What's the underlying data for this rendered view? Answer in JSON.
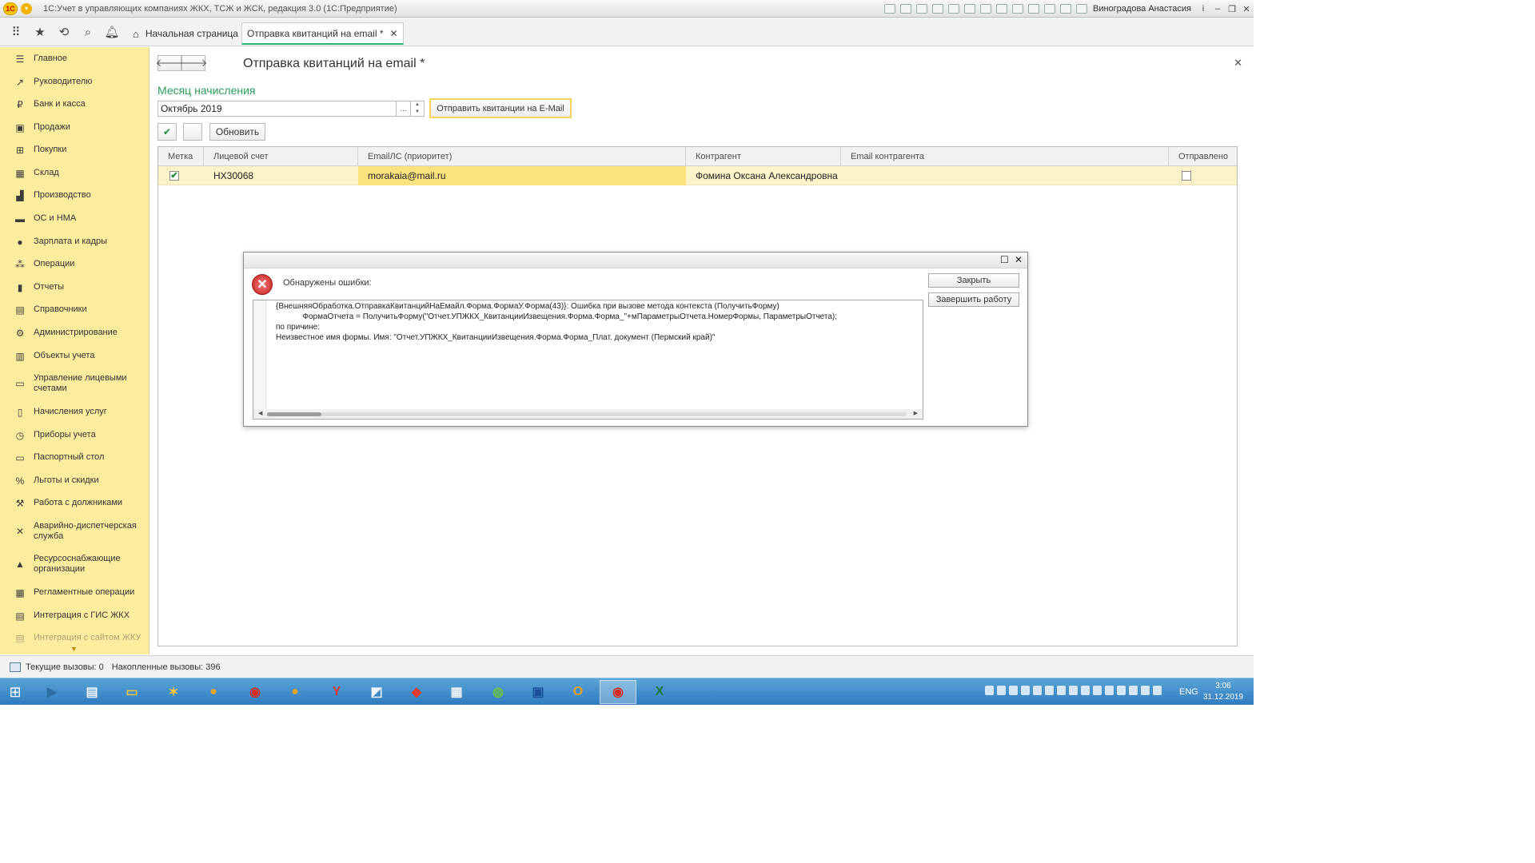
{
  "window": {
    "app_title": "1С:Учет в управляющих компаниях ЖКХ, ТСЖ и ЖСК, редакция 3.0  (1С:Предприятие)",
    "logo_text": "1С",
    "user_name": "Виноградова Анастасия",
    "controls": {
      "info": "i",
      "minimize": "–",
      "restore": "❐",
      "close": "✕"
    }
  },
  "tabs": [
    {
      "label": "Начальная страница",
      "icon": "home-icon"
    },
    {
      "label": "Отправка квитанций на email *",
      "active": true,
      "close": "✕"
    }
  ],
  "toolbar_icons": [
    "apps-grid-icon",
    "star-icon",
    "history-icon",
    "search-icon",
    "bell-icon"
  ],
  "sidebar": {
    "items": [
      {
        "label": "Главное",
        "icon": "menu-icon"
      },
      {
        "label": "Руководителю",
        "icon": "trend-icon"
      },
      {
        "label": "Банк и касса",
        "icon": "ruble-icon"
      },
      {
        "label": "Продажи",
        "icon": "bag-icon"
      },
      {
        "label": "Покупки",
        "icon": "cart-icon"
      },
      {
        "label": "Склад",
        "icon": "warehouse-icon"
      },
      {
        "label": "Производство",
        "icon": "factory-icon"
      },
      {
        "label": "ОС и НМА",
        "icon": "truck-icon"
      },
      {
        "label": "Зарплата и кадры",
        "icon": "person-icon"
      },
      {
        "label": "Операции",
        "icon": "operations-icon"
      },
      {
        "label": "Отчеты",
        "icon": "bar-chart-icon"
      },
      {
        "label": "Справочники",
        "icon": "book-icon"
      },
      {
        "label": "Администрирование",
        "icon": "gear-icon"
      },
      {
        "label": "Объекты учета",
        "icon": "buildings-icon"
      },
      {
        "label": "Управление лицевыми счетами",
        "icon": "card-icon"
      },
      {
        "label": "Начисления услуг",
        "icon": "document-icon"
      },
      {
        "label": "Приборы учета",
        "icon": "meter-icon"
      },
      {
        "label": "Паспортный стол",
        "icon": "passport-icon"
      },
      {
        "label": "Льготы и скидки",
        "icon": "percent-icon"
      },
      {
        "label": "Работа с должниками",
        "icon": "gavel-icon"
      },
      {
        "label": "Аварийно-диспетчерская служба",
        "icon": "tools-icon"
      },
      {
        "label": "Ресурсоснабжающие организации",
        "icon": "resource-icon"
      },
      {
        "label": "Регламентные операции",
        "icon": "regulation-icon"
      },
      {
        "label": "Интеграция с ГИС ЖКХ",
        "icon": "integration-icon"
      },
      {
        "label": "Интеграция с сайтом ЖКУ",
        "icon": "site-icon"
      }
    ]
  },
  "form": {
    "title": "Отправка квитанций на email *",
    "back": "🡐",
    "forward": "🡒",
    "close": "✕",
    "month_label": "Месяц начисления",
    "month_value": "Октябрь 2019",
    "select_button": "...",
    "send_button": "Отправить квитанции на E-Mail",
    "check_all": "✔",
    "refresh_button": "Обновить"
  },
  "table": {
    "columns": [
      "Метка",
      "Лицевой счет",
      "EmailЛС (приоритет)",
      "Контрагент",
      "Email контрагента",
      "Отправлено"
    ],
    "rows": [
      {
        "mark": "✔",
        "account": "НХ30068",
        "email": "morakaia@mail.ru",
        "counterparty": "Фомина Оксана Александровна",
        "counterparty_email": "",
        "sent": ""
      }
    ]
  },
  "error_dialog": {
    "maximize": "☐",
    "close": "✕",
    "icon": "✕",
    "title": "Обнаружены ошибки:",
    "lines": [
      "{ВнешняяОбработка.ОтправкаКвитанцийНаЕмайл.Форма.ФормаУ.Форма(43)}: Ошибка при вызове метода контекста (ПолучитьФорму)",
      "            ФормаОтчета = ПолучитьФорму(\"Отчет.УПЖКХ_КвитанцииИзвещения.Форма.Форма_\"+мПараметрыОтчета.НомерФормы, ПараметрыОтчета);",
      "по причине:",
      "Неизвестное имя формы. Имя: \"Отчет.УПЖКХ_КвитанцииИзвещения.Форма.Форма_Плат. документ (Пермский край)\""
    ],
    "close_button": "Закрыть",
    "exit_button": "Завершить работу"
  },
  "status_bar": {
    "current_calls": "Текущие вызовы: 0",
    "accumulated_calls": "Накопленные вызовы: 396"
  },
  "taskbar": {
    "language": "ENG",
    "time": "3:06",
    "date": "31.12.2019"
  },
  "colors": {
    "sidebar_bg": "#fbec9e",
    "accent_green": "#2a9d5a",
    "selection": "#fdf3c8",
    "taskbar": "#2f7bbf"
  }
}
